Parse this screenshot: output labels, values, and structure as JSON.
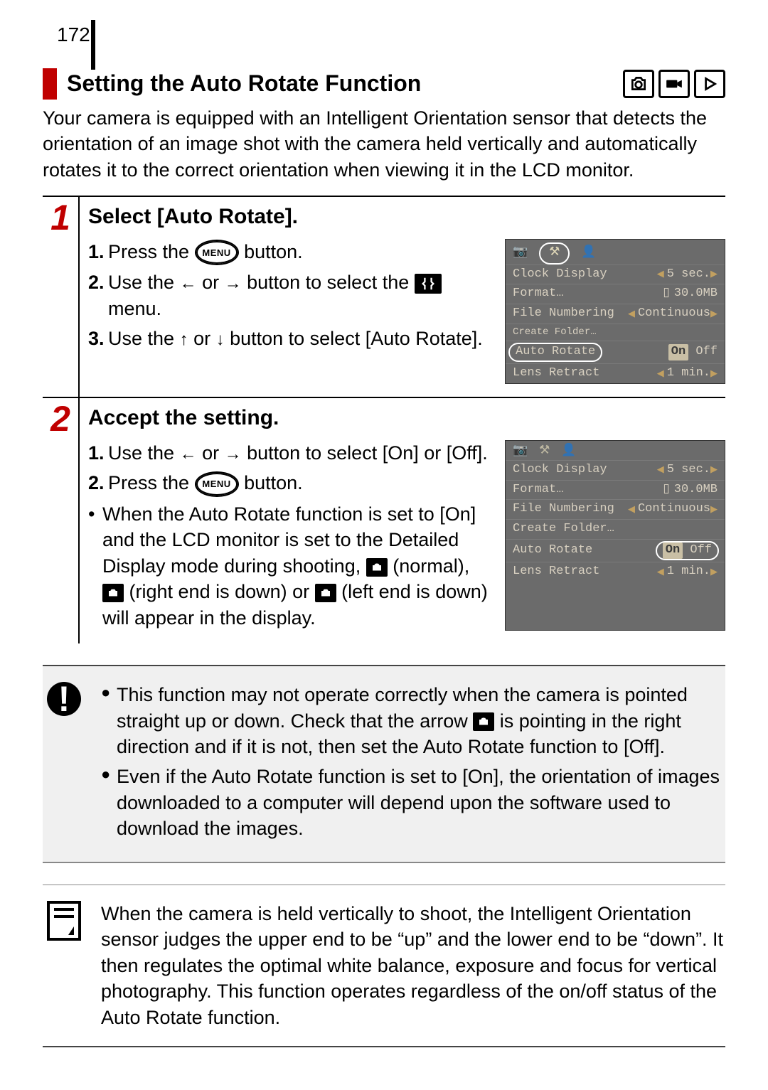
{
  "page_number": "172",
  "title": "Setting the Auto Rotate Function",
  "intro": "Your camera is equipped with an Intelligent Orientation sensor that detects the orientation of an image shot with the camera held vertically and automatically rotates it to the correct orientation when viewing it in the LCD monitor.",
  "mode_icons": [
    "camera-icon",
    "video-icon",
    "play-icon"
  ],
  "step1": {
    "title": "Select [Auto Rotate].",
    "s1a": "Press the ",
    "s1b": " button.",
    "s2a": "Use the ",
    "s2b": " or ",
    "s2c": " button to select the ",
    "s2d": " menu.",
    "s3a": "Use the ",
    "s3b": " or ",
    "s3c": " button to select [Auto Rotate].",
    "menu_label": "MENU"
  },
  "step2": {
    "title": "Accept the setting.",
    "s1a": "Use the ",
    "s1b": " or ",
    "s1c": " button to select [On] or [Off].",
    "s2a": "Press the ",
    "s2b": " button.",
    "bullet_a": "When the Auto Rotate function is set to [On] and the LCD monitor is set to the Detailed Display mode during shooting, ",
    "bullet_b": " (normal), ",
    "bullet_c": " (right end is down) or ",
    "bullet_d": " (left end is down) will appear in the display."
  },
  "lcd": {
    "clock_display": {
      "label": "Clock Display",
      "value": "5 sec."
    },
    "format": {
      "label": "Format…",
      "value": "30.0MB"
    },
    "file_numbering": {
      "label": "File Numbering",
      "value": "Continuous"
    },
    "create_folder": {
      "label": "Create Folder…"
    },
    "auto_rotate": {
      "label": "Auto Rotate",
      "on": "On",
      "off": "Off"
    },
    "lens_retract": {
      "label": "Lens Retract",
      "value": "1 min."
    }
  },
  "caution": {
    "b1a": "This function may not operate correctly when the camera is pointed straight up or down. Check that the arrow ",
    "b1b": " is pointing in the right direction and if it is not, then set the Auto Rotate function to [Off].",
    "b2": "Even if the Auto Rotate function is set to [On], the orientation of images downloaded to a computer will depend upon the software used to download the images."
  },
  "memo": "When the camera is held vertically to shoot, the Intelligent Orientation sensor judges the upper end to be “up” and the lower end to be “down”. It then regulates the optimal white balance, exposure and focus for vertical photography. This function operates regardless of the on/off status of the Auto Rotate function."
}
